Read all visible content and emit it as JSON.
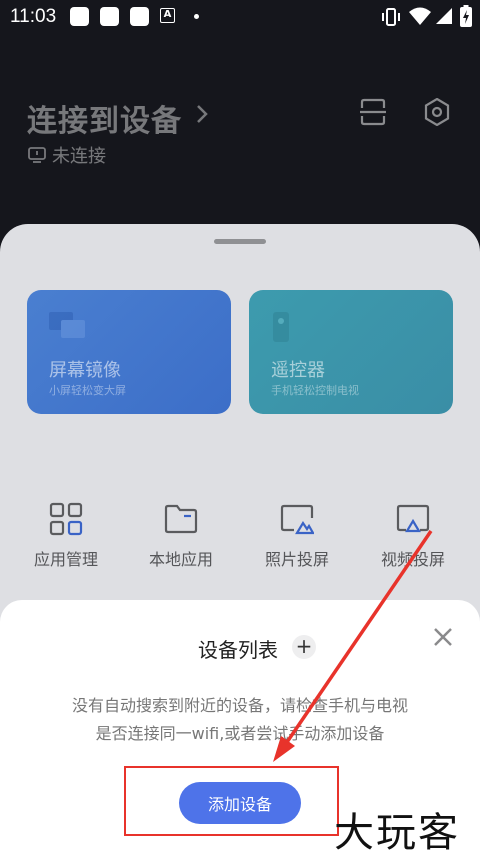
{
  "status_bar": {
    "time": "11:03",
    "icons": [
      "notification-square-icon",
      "notification-square-icon",
      "notification-square-icon",
      "a-icon",
      "dot-icon",
      "vibrate-icon",
      "wifi-icon",
      "signal-icon",
      "battery-icon"
    ]
  },
  "header": {
    "title": "连接到设备",
    "subtitle": "未连接",
    "icons": [
      "scan-icon",
      "settings-icon"
    ]
  },
  "cards": [
    {
      "title": "屏幕镜像",
      "subtitle": "小屏轻松变大屏",
      "color": "#4a7fd0"
    },
    {
      "title": "遥控器",
      "subtitle": "手机轻松控制电视",
      "color": "#3d9bae"
    }
  ],
  "tools": [
    {
      "label": "应用管理",
      "icon": "apps-grid-icon"
    },
    {
      "label": "本地应用",
      "icon": "folder-icon"
    },
    {
      "label": "照片投屏",
      "icon": "photo-cast-icon"
    },
    {
      "label": "视频投屏",
      "icon": "video-cast-icon"
    }
  ],
  "sheet": {
    "title": "设备列表",
    "plus": "+",
    "message_line1": "没有自动搜索到附近的设备，请检查手机与电视",
    "message_line2": "是否连接同一wifi,或者尝试手动添加设备",
    "button_label": "添加设备",
    "button_color": "#4e73e9"
  },
  "annotation": {
    "color": "#e8332b"
  },
  "watermark": "大玩客"
}
